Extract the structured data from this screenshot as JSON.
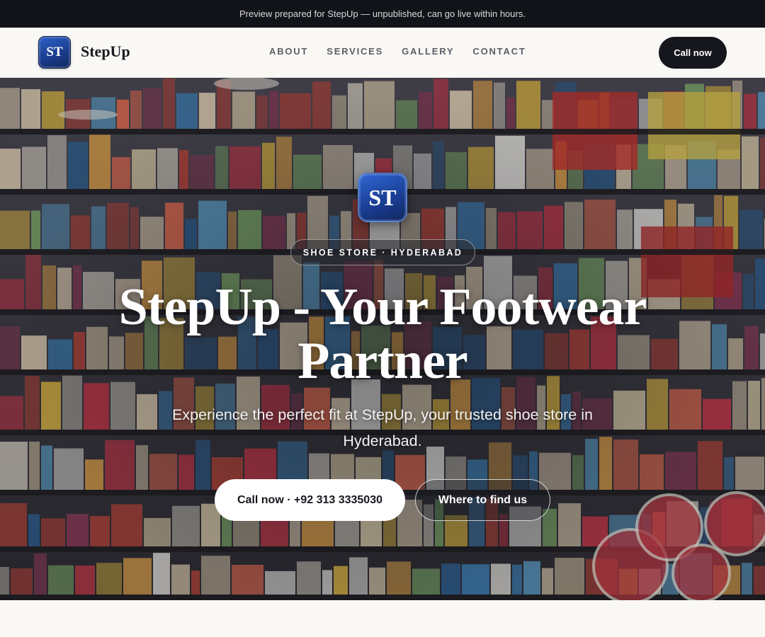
{
  "preview_bar": {
    "text": "Preview prepared for StepUp — unpublished, can go live within hours."
  },
  "header": {
    "logo_initials": "ST",
    "brand_name": "StepUp",
    "nav": [
      "ABOUT",
      "SERVICES",
      "GALLERY",
      "CONTACT"
    ],
    "cta_label": "Call now"
  },
  "hero": {
    "badge_initials": "ST",
    "tag": "SHOE STORE · HYDERABAD",
    "title": "StepUp - Your Footwear Partner",
    "subtitle": "Experience the perfect fit at StepUp, your trusted shoe store in Hyderabad.",
    "primary_button": "Call now · +92 313 3335030",
    "secondary_button": "Where to find us",
    "background_image": "store-shelves-photo"
  },
  "colors": {
    "preview_bar_bg": "#111318",
    "header_bg": "#f9f8f5",
    "button_dark": "#15171c",
    "logo_blue": "#1a3d8f"
  }
}
